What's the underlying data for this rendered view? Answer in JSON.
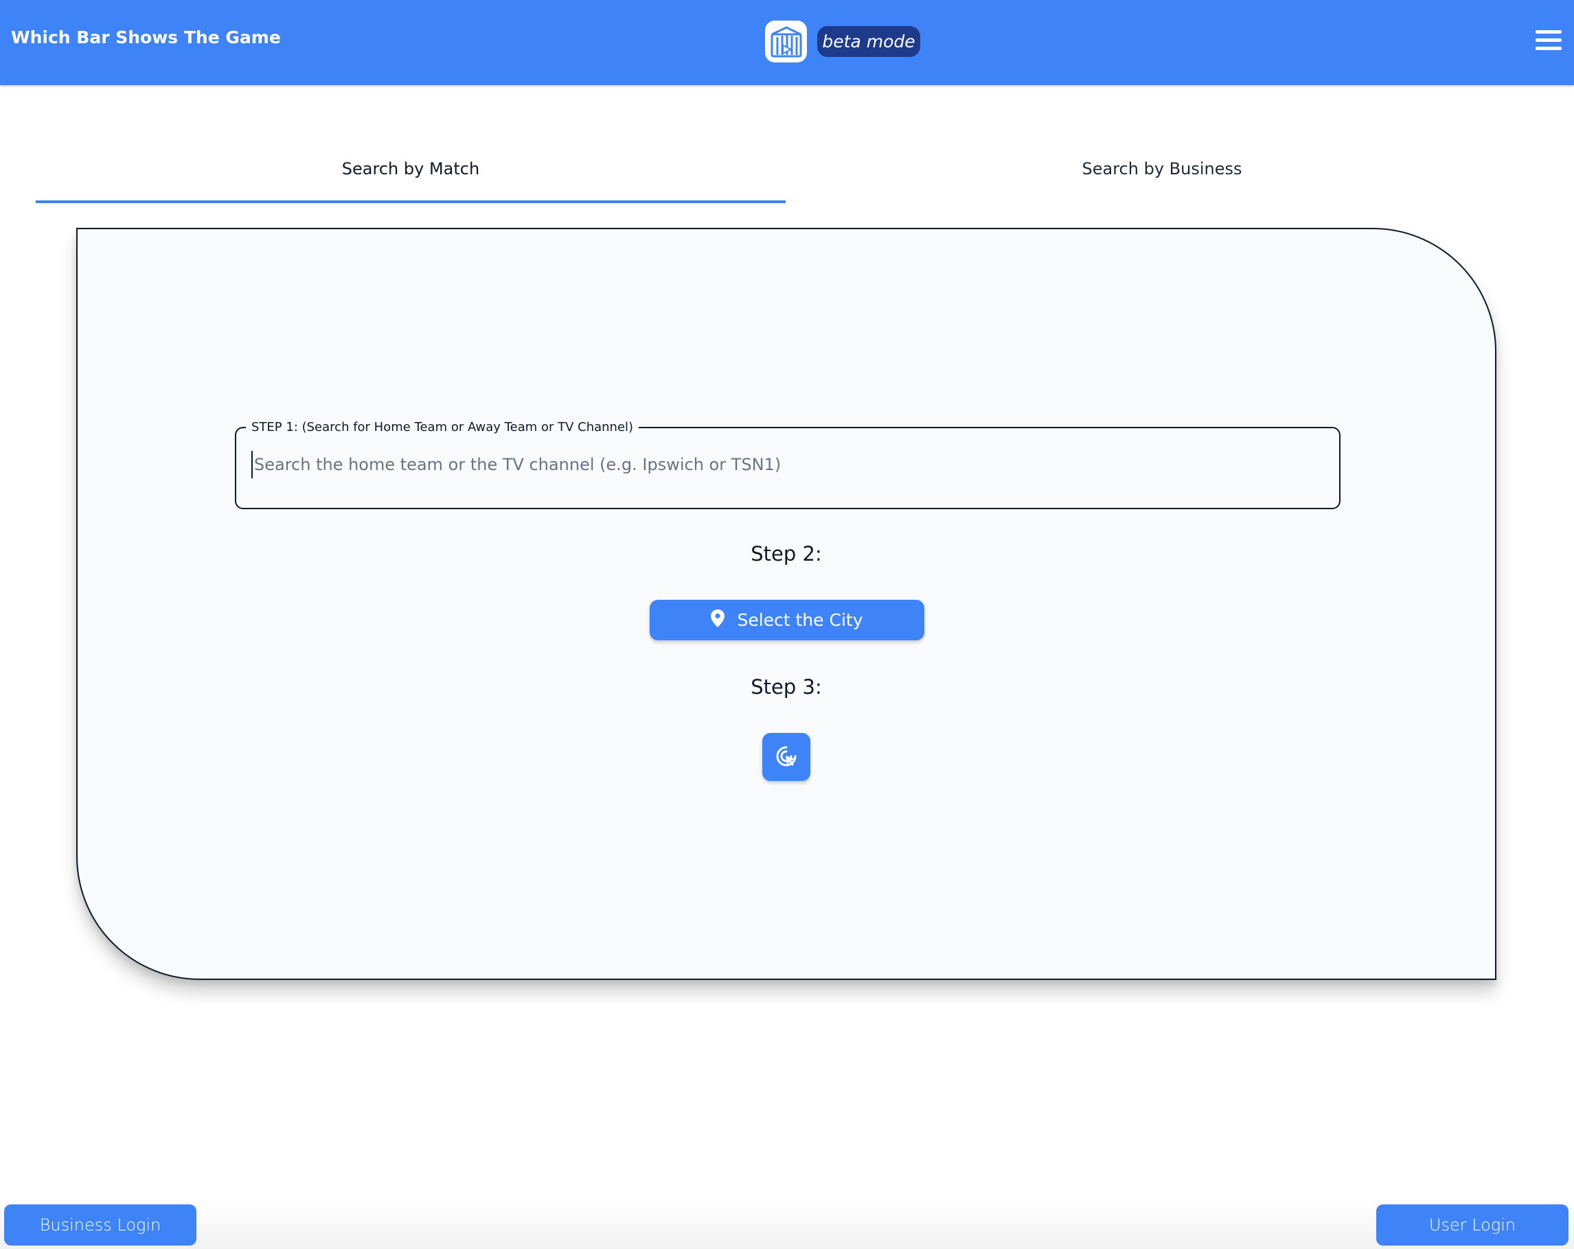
{
  "header": {
    "title": "Which Bar Shows The Game",
    "beta_label": "beta mode",
    "logo_icon": "bar-building-logo-icon",
    "menu_icon": "hamburger-menu-icon",
    "color": "#3f83f8"
  },
  "tabs": [
    {
      "label": "Search by Match",
      "active": true
    },
    {
      "label": "Search by Business",
      "active": false
    }
  ],
  "search_card": {
    "step1": {
      "legend": "STEP 1: (Search for Home Team or Away Team or TV Channel)",
      "placeholder": "Search the home team or the TV channel (e.g. Ipswich or TSN1)",
      "value": ""
    },
    "step2": {
      "label": "Step 2:",
      "button_label": "Select the City",
      "button_icon": "location-pin-icon"
    },
    "step3": {
      "label": "Step 3:",
      "button_icon": "click-cursor-icon"
    }
  },
  "footer": {
    "business_login": "Business Login",
    "user_login": "User Login"
  },
  "colors": {
    "primary": "#3f83f8",
    "badge": "#1e3a8a",
    "card_background": "#f9fafb"
  }
}
